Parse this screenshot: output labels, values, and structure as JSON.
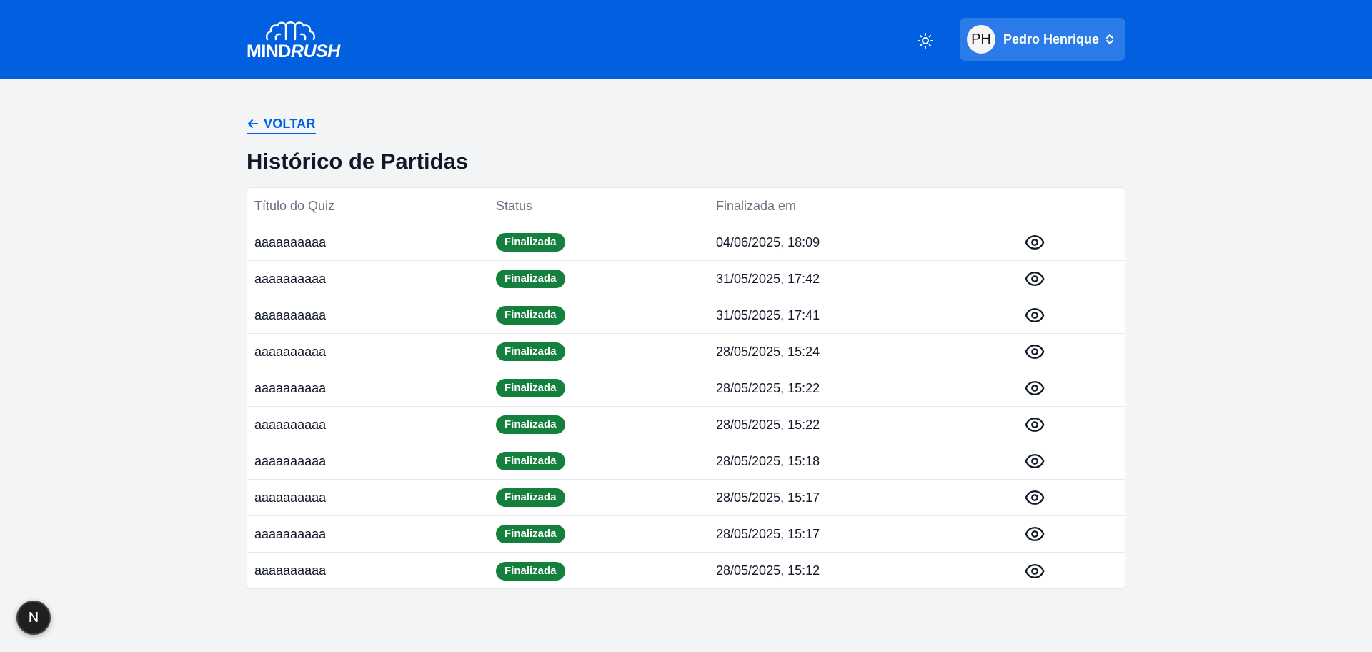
{
  "header": {
    "brand_mind": "MIND",
    "brand_rush": "RUSH",
    "theme_icon": "sun-icon",
    "user": {
      "initials": "PH",
      "name": "Pedro Henrique"
    }
  },
  "back_label": "VOLTAR",
  "page_title": "Histórico de Partidas",
  "table": {
    "columns": [
      "Título do Quiz",
      "Status",
      "Finalizada em"
    ],
    "rows": [
      {
        "title": "aaaaaaaaaa",
        "status": "Finalizada",
        "finished_at": "04/06/2025, 18:09"
      },
      {
        "title": "aaaaaaaaaa",
        "status": "Finalizada",
        "finished_at": "31/05/2025, 17:42"
      },
      {
        "title": "aaaaaaaaaa",
        "status": "Finalizada",
        "finished_at": "31/05/2025, 17:41"
      },
      {
        "title": "aaaaaaaaaa",
        "status": "Finalizada",
        "finished_at": "28/05/2025, 15:24"
      },
      {
        "title": "aaaaaaaaaa",
        "status": "Finalizada",
        "finished_at": "28/05/2025, 15:22"
      },
      {
        "title": "aaaaaaaaaa",
        "status": "Finalizada",
        "finished_at": "28/05/2025, 15:22"
      },
      {
        "title": "aaaaaaaaaa",
        "status": "Finalizada",
        "finished_at": "28/05/2025, 15:18"
      },
      {
        "title": "aaaaaaaaaa",
        "status": "Finalizada",
        "finished_at": "28/05/2025, 15:17"
      },
      {
        "title": "aaaaaaaaaa",
        "status": "Finalizada",
        "finished_at": "28/05/2025, 15:17"
      },
      {
        "title": "aaaaaaaaaa",
        "status": "Finalizada",
        "finished_at": "28/05/2025, 15:12"
      }
    ]
  },
  "dev_badge": "N",
  "colors": {
    "primary": "#0060df",
    "status_green": "#15803d",
    "background": "#f3f4f6"
  }
}
